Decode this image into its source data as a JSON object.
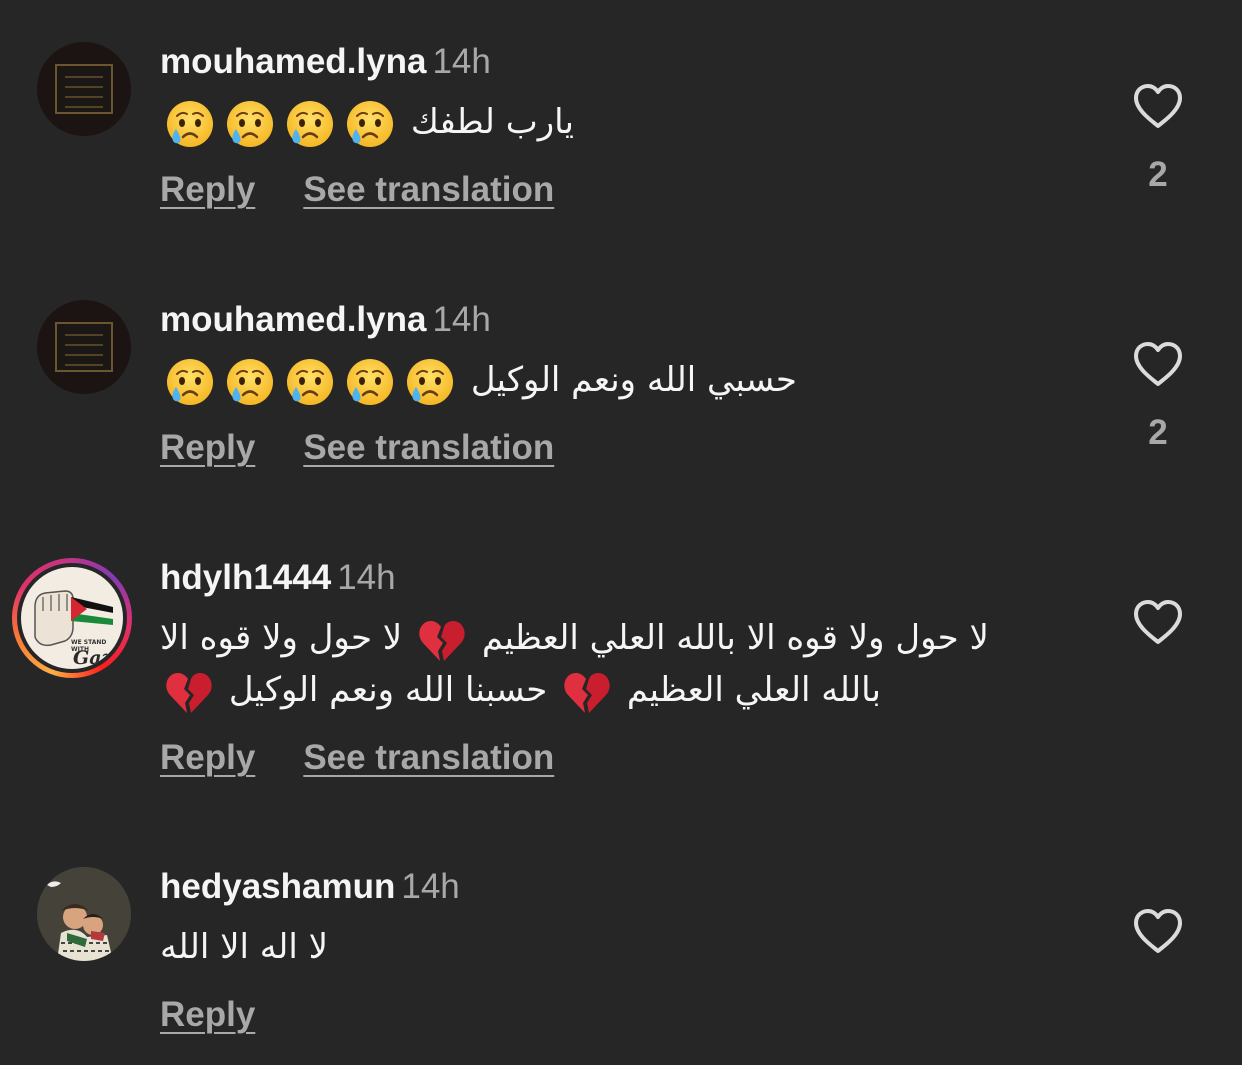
{
  "comments": [
    {
      "username": "mouhamed.lyna",
      "time": "14h",
      "text": "يارب لطفك",
      "emoji_count": 4,
      "emoji": "crying-face",
      "reply_label": "Reply",
      "translate_label": "See translation",
      "likes": "2"
    },
    {
      "username": "mouhamed.lyna",
      "time": "14h",
      "text": "حسبي الله ونعم الوكيل",
      "emoji_count": 5,
      "emoji": "crying-face",
      "reply_label": "Reply",
      "translate_label": "See translation",
      "likes": "2"
    },
    {
      "username": "hdylh1444",
      "time": "14h",
      "text_part1": "لا حول ولا قوه الا بالله العلي العظيم",
      "text_part2": "لا حول ولا قوه الا بالله العلي العظيم",
      "text_part3": "حسبنا الله ونعم الوكيل",
      "emoji": "broken-heart",
      "avatar_caption_top": "WE STAND WITH",
      "avatar_caption_bottom": "Gaza",
      "reply_label": "Reply",
      "translate_label": "See translation",
      "likes": ""
    },
    {
      "username": "hedyashamun",
      "time": "14h",
      "text": "لا اله الا الله",
      "reply_label": "Reply",
      "likes": ""
    }
  ],
  "colors": {
    "background": "#262626",
    "primary_text": "#f5f5f5",
    "secondary_text": "#a8a8a8",
    "heart_outline": "#dbdbdb"
  },
  "icons": {
    "like": "heart-outline-icon",
    "crying": "crying-face-emoji",
    "broken": "broken-heart-emoji"
  }
}
